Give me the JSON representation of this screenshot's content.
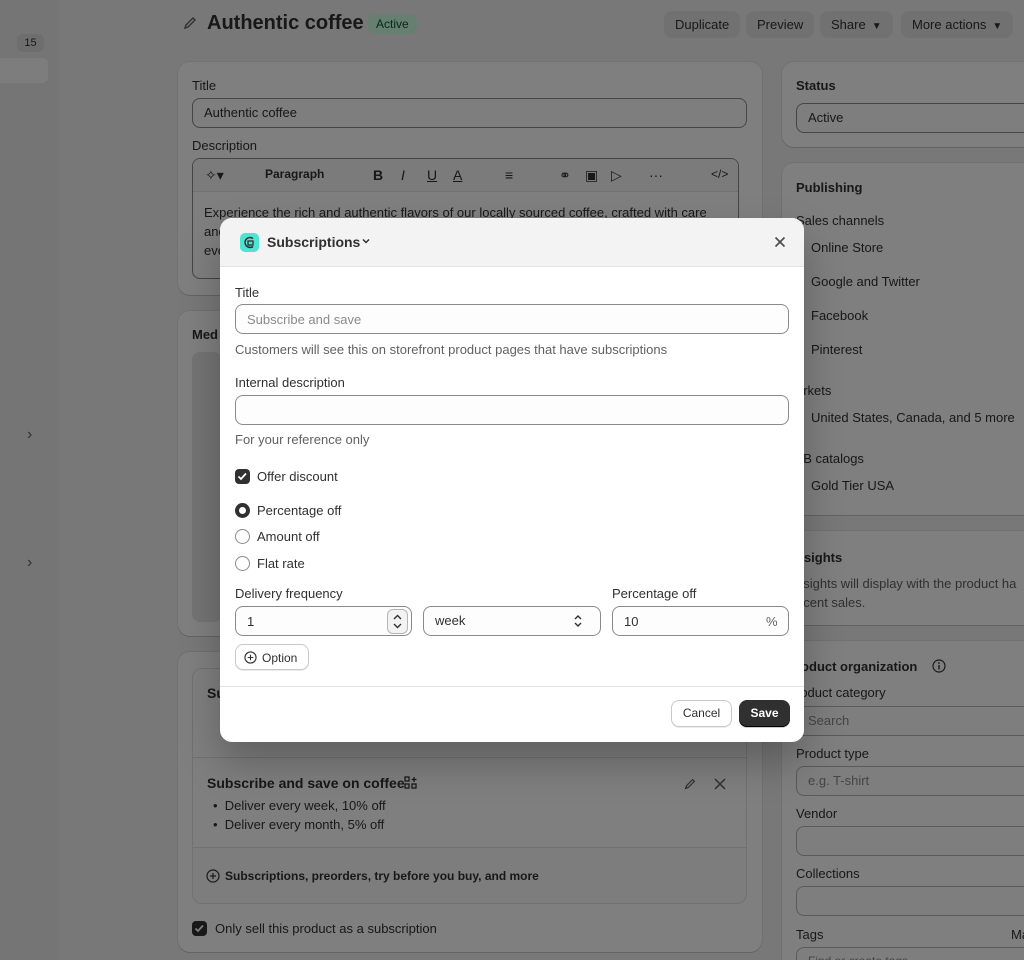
{
  "sidebar": {
    "badge": "15"
  },
  "header": {
    "title": "Authentic coffee",
    "status_badge": "Active",
    "buttons": {
      "duplicate": "Duplicate",
      "preview": "Preview",
      "share": "Share",
      "more_actions": "More actions"
    }
  },
  "product": {
    "title_label": "Title",
    "title_value": "Authentic coffee",
    "description_label": "Description",
    "editor": {
      "format": "Paragraph",
      "bold": "B",
      "italic": "I",
      "underline": "U",
      "text_color": "A",
      "more": "···",
      "code": "</>"
    },
    "description_lines": [
      "Experience the rich and authentic flavors of our locally sourced coffee, crafted with care",
      "and",
      "eve"
    ],
    "media_label": "Med",
    "subscriptions_card": {
      "first_item_title": "Su",
      "second_item_title": "Subscribe and save on coffee",
      "second_item_bullets": [
        "Deliver every week, 10% off",
        "Deliver every month, 5% off"
      ],
      "link": "Subscriptions, preorders, try before you buy, and more",
      "only_subscription": "Only sell this product as a subscription"
    }
  },
  "right_column": {
    "status_label": "Status",
    "status_value": "Active",
    "publishing_label": "Publishing",
    "sales_channels_label": "Sales channels",
    "sales_channels": [
      "Online Store",
      "Google and Twitter",
      "Facebook",
      "Pinterest"
    ],
    "markets_label": "arkets",
    "markets_value": "United States, Canada, and 5 more",
    "b2b_label": "2B catalogs",
    "b2b_value": "Gold Tier USA",
    "insights_label": "nsights",
    "insights_text": [
      "nsights will display with the product ha",
      "ecent sales."
    ],
    "product_org_label": "roduct organization",
    "product_category_label": "roduct category",
    "product_category_placeholder": "Search",
    "product_type_label": "Product type",
    "product_type_placeholder": "e.g. T-shirt",
    "vendor_label": "Vendor",
    "collections_label": "Collections",
    "tags_label": "Tags",
    "tags_manage": "Ma",
    "tags_placeholder": "Find or create tags"
  },
  "modal": {
    "title": "Subscriptions",
    "title_field": {
      "label": "Title",
      "placeholder": "Subscribe and save",
      "help": "Customers will see this on storefront product pages that have subscriptions"
    },
    "internal_description": {
      "label": "Internal description",
      "value": "",
      "help": "For your reference only"
    },
    "offer_discount": {
      "label": "Offer discount",
      "checked": true
    },
    "discount_types": [
      {
        "label": "Percentage off",
        "selected": true
      },
      {
        "label": "Amount off",
        "selected": false
      },
      {
        "label": "Flat rate",
        "selected": false
      }
    ],
    "delivery_frequency": {
      "label": "Delivery frequency",
      "value": "1",
      "unit": "week"
    },
    "percentage_off": {
      "label": "Percentage off",
      "value": "10",
      "suffix": "%"
    },
    "option_button": "Option",
    "cancel": "Cancel",
    "save": "Save"
  }
}
